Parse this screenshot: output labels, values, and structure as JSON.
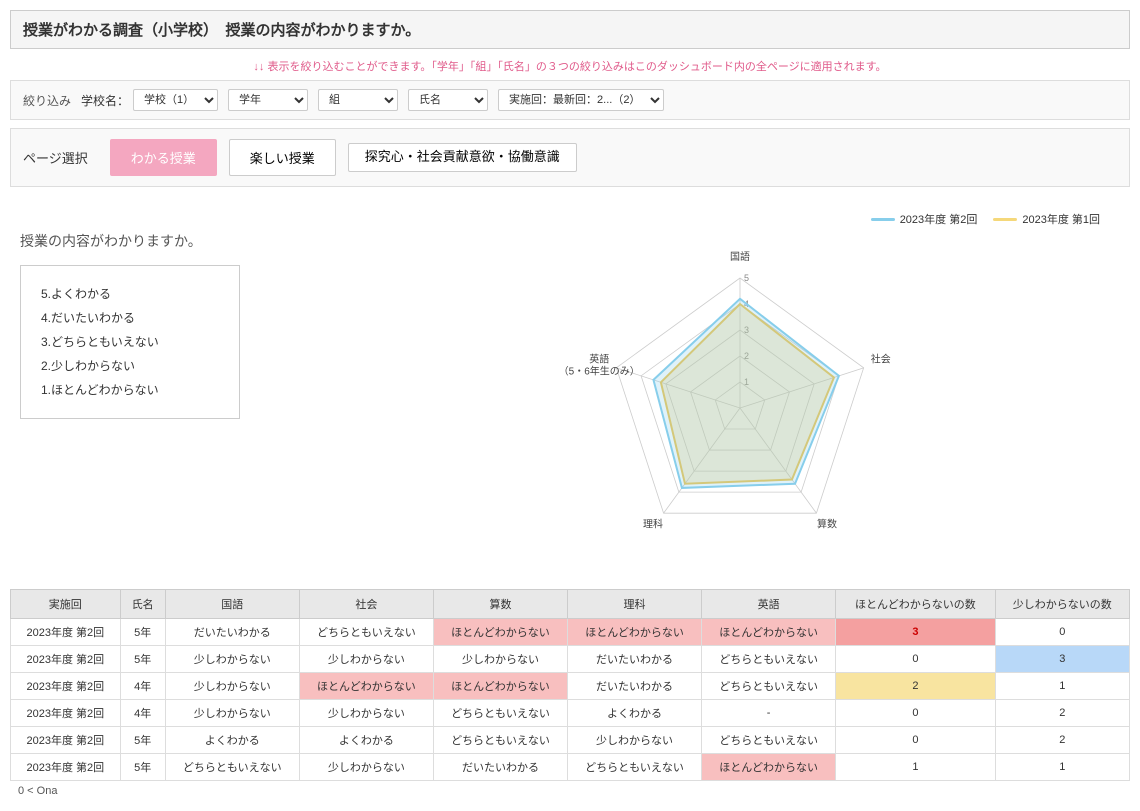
{
  "header": {
    "title": "授業がわかる調査（小学校）　授業の内容がわかりますか。"
  },
  "notice": "↓↓ 表示を絞り込むことができます。「学年」「組」「氏名」の３つの絞り込みはこのダッシュボード内の全ページに適用されます。",
  "filter": {
    "label": "絞り込み",
    "school_label": "学校名：",
    "school_value": "学校（1）",
    "grade_label": "学年",
    "class_label": "組",
    "name_label": "氏名",
    "date_label": "実施回：最新回：2...（2）"
  },
  "page_select": {
    "label": "ページ選択",
    "buttons": [
      {
        "id": "wakaru",
        "label": "わかる授業",
        "active": true
      },
      {
        "id": "tanoshii",
        "label": "楽しい授業",
        "active": false
      },
      {
        "id": "tankyu",
        "label": "探究心・社会貢献意欲・協働意識",
        "active": false
      }
    ]
  },
  "chart": {
    "question": "授業の内容がわかりますか。",
    "scale": [
      "5.よくわかる",
      "4.だいたいわかる",
      "3.どちらともいえない",
      "2.少しわからない",
      "1.ほとんどわからない"
    ],
    "legend": [
      {
        "id": "r2",
        "label": "2023年度 第2回",
        "color": "#87ceeb"
      },
      {
        "id": "r1",
        "label": "2023年度 第1回",
        "color": "#f5d87a"
      }
    ],
    "axes": [
      "国語",
      "社会",
      "算数",
      "理科",
      "英語（5・6年生のみ）"
    ],
    "series": [
      {
        "id": "r2",
        "color": "#87ceeb",
        "values": [
          4.2,
          4.0,
          3.6,
          3.8,
          3.5
        ]
      },
      {
        "id": "r1",
        "color": "#d4c87a",
        "values": [
          4.0,
          3.8,
          3.4,
          3.6,
          3.2
        ]
      }
    ]
  },
  "table": {
    "headers": [
      "実施回",
      "氏名",
      "国語",
      "社会",
      "算数",
      "理科",
      "英語",
      "ほとんどわからないの数",
      "少しわからないの数"
    ],
    "rows": [
      {
        "jisshikai": "2023年度 第2回",
        "shimei": "5年",
        "kokugo": "だいたいわかる",
        "shakai": "どちらともいえない",
        "sansuu": "ほとんどわからない",
        "rika": "ほとんどわからない",
        "eigo": "ほとんどわからない",
        "count_hotondo": "3",
        "count_sukoshi": "0",
        "sansuu_hi": "red",
        "rika_hi": "red",
        "eigo_hi": "red",
        "count_hotondo_hi": "red",
        "count_sukoshi_hi": ""
      },
      {
        "jisshikai": "2023年度 第2回",
        "shimei": "5年",
        "kokugo": "少しわからない",
        "shakai": "少しわからない",
        "sansuu": "少しわからない",
        "rika": "だいたいわかる",
        "eigo": "どちらともいえない",
        "count_hotondo": "0",
        "count_sukoshi": "3",
        "sansuu_hi": "",
        "rika_hi": "",
        "eigo_hi": "",
        "count_hotondo_hi": "",
        "count_sukoshi_hi": "blue"
      },
      {
        "jisshikai": "2023年度 第2回",
        "shimei": "4年",
        "kokugo": "少しわからない",
        "shakai": "ほとんどわからない",
        "sansuu": "ほとんどわからない",
        "rika": "だいたいわかる",
        "eigo": "どちらともいえない",
        "count_hotondo": "2",
        "count_sukoshi": "1",
        "sansuu_hi": "red",
        "rika_hi": "",
        "eigo_hi": "",
        "shakai_hi": "red",
        "count_hotondo_hi": "yellow",
        "count_sukoshi_hi": ""
      },
      {
        "jisshikai": "2023年度 第2回",
        "shimei": "4年",
        "kokugo": "少しわからない",
        "shakai": "少しわからない",
        "sansuu": "どちらともいえない",
        "rika": "よくわかる",
        "eigo": "-",
        "count_hotondo": "0",
        "count_sukoshi": "2",
        "sansuu_hi": "",
        "rika_hi": "",
        "eigo_hi": "",
        "count_hotondo_hi": "",
        "count_sukoshi_hi": ""
      },
      {
        "jisshikai": "2023年度 第2回",
        "shimei": "5年",
        "kokugo": "よくわかる",
        "shakai": "よくわかる",
        "sansuu": "どちらともいえない",
        "rika": "少しわからない",
        "eigo": "どちらともいえない",
        "count_hotondo": "0",
        "count_sukoshi": "2",
        "sansuu_hi": "",
        "rika_hi": "",
        "eigo_hi": "",
        "count_hotondo_hi": "",
        "count_sukoshi_hi": ""
      },
      {
        "jisshikai": "2023年度 第2回",
        "shimei": "5年",
        "kokugo": "どちらともいえない",
        "shakai": "少しわからない",
        "sansuu": "だいたいわかる",
        "rika": "どちらともいえない",
        "eigo": "ほとんどわからない",
        "count_hotondo": "1",
        "count_sukoshi": "1",
        "sansuu_hi": "",
        "rika_hi": "",
        "eigo_hi": "red",
        "count_hotondo_hi": "",
        "count_sukoshi_hi": ""
      }
    ]
  }
}
